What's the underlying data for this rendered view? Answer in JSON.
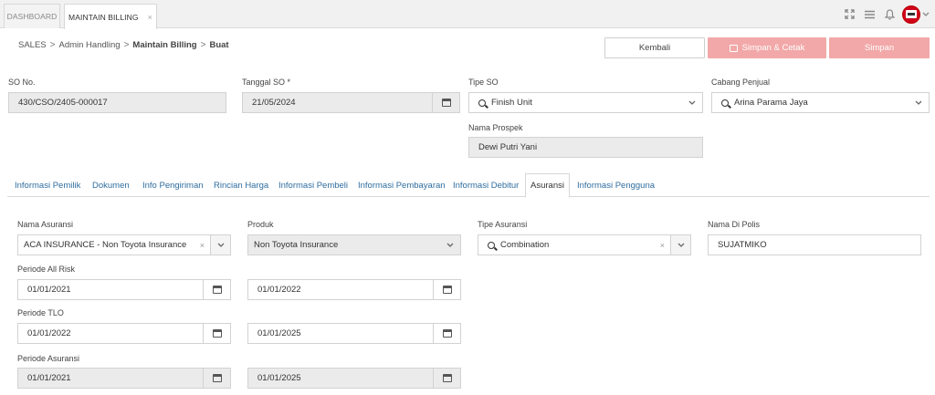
{
  "tabs": [
    {
      "label": "DASHBOARD"
    },
    {
      "label": "MAINTAIN BILLING",
      "close": "×"
    }
  ],
  "header_icons": [
    "expand-icon",
    "list-icon",
    "bell-icon",
    "avatar",
    "chevron-down-icon"
  ],
  "breadcrumb": {
    "items": [
      "SALES",
      "Admin Handling",
      "Maintain Billing",
      "Buat"
    ],
    "separator": ">"
  },
  "actions": {
    "kembali": "Kembali",
    "simpan_cetak": "Simpan & Cetak",
    "simpan": "Simpan",
    "accent_color": "#f2a8a8"
  },
  "form": {
    "so_no": {
      "label": "SO No.",
      "value": "430/CSO/2405-000017"
    },
    "tanggal_so": {
      "label": "Tanggal SO",
      "required": "*",
      "value": "21/05/2024"
    },
    "tipe_so": {
      "label": "Tipe SO",
      "value": "Finish Unit"
    },
    "cabang_penjual": {
      "label": "Cabang Penjual",
      "value": "Arina Parama Jaya"
    },
    "nama_prospek": {
      "label": "Nama Prospek",
      "value": "Dewi Putri Yani"
    }
  },
  "content_tabs": [
    "Informasi Pemilik",
    "Dokumen",
    "Info Pengiriman",
    "Rincian Harga",
    "Informasi Pembeli",
    "Informasi Pembayaran",
    "Informasi Debitur",
    "Asuransi",
    "Informasi Pengguna"
  ],
  "active_content_tab": "Asuransi",
  "asuransi": {
    "nama_asuransi": {
      "label": "Nama Asuransi",
      "value": "ACA INSURANCE - Non Toyota Insurance"
    },
    "produk": {
      "label": "Produk",
      "value": "Non Toyota Insurance"
    },
    "tipe_asuransi": {
      "label": "Tipe Asuransi",
      "value": "Combination"
    },
    "nama_di_polis": {
      "label": "Nama Di Polis",
      "value": "SUJATMIKO"
    },
    "periode_all_risk": {
      "label": "Periode All Risk",
      "start": "01/01/2021",
      "end": "01/01/2022"
    },
    "periode_tlo": {
      "label": "Periode TLO",
      "start": "01/01/2022",
      "end": "01/01/2025"
    },
    "periode_asuransi": {
      "label": "Periode Asuransi",
      "start": "01/01/2021",
      "end": "01/01/2025"
    },
    "clear": "×"
  }
}
